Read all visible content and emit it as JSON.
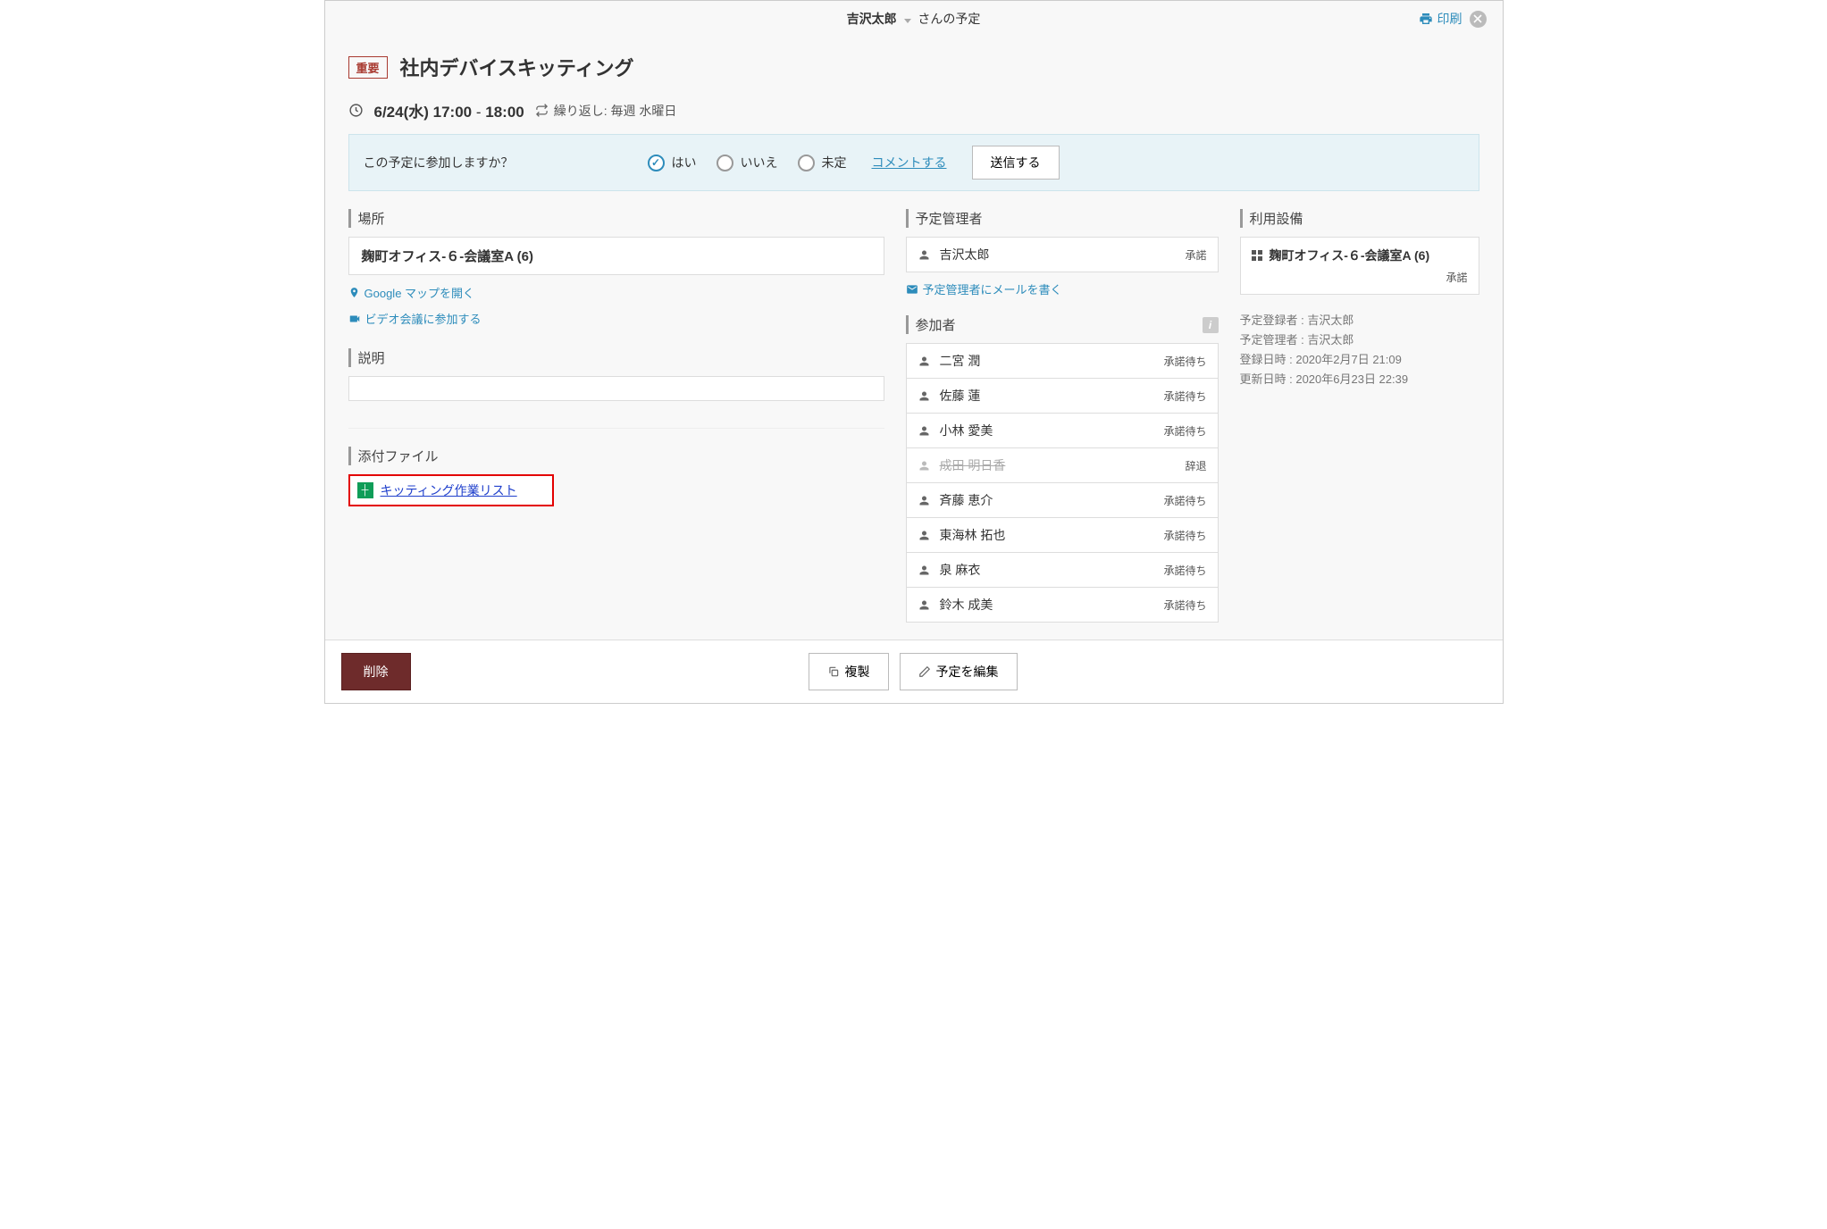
{
  "header": {
    "user": "吉沢太郎",
    "suffix": "さんの予定",
    "print": "印刷"
  },
  "event": {
    "tag": "重要",
    "title": "社内デバイスキッティング",
    "date": "6/24(水) 17:00",
    "date_sep": "-",
    "date_end": "18:00",
    "repeat": "繰り返し: 毎週 水曜日"
  },
  "rsvp": {
    "question": "この予定に参加しますか？",
    "yes": "はい",
    "no": "いいえ",
    "undecided": "未定",
    "comment": "コメントする",
    "submit": "送信する"
  },
  "sections": {
    "location": "場所",
    "description": "説明",
    "attachments": "添付ファイル",
    "organizer": "予定管理者",
    "participants": "参加者",
    "facility": "利用設備"
  },
  "location": {
    "text": "麹町オフィス-６-会議室A (6)",
    "map_link": "Google マップを開く",
    "video_link": "ビデオ会議に参加する"
  },
  "attachments": [
    {
      "name": "キッティング作業リスト"
    }
  ],
  "organizer": {
    "name": "吉沢太郎",
    "status": "承諾",
    "email_link": "予定管理者にメールを書く"
  },
  "participants": [
    {
      "name": "二宮 潤",
      "status": "承諾待ち",
      "declined": false
    },
    {
      "name": "佐藤 蓮",
      "status": "承諾待ち",
      "declined": false
    },
    {
      "name": "小林 愛美",
      "status": "承諾待ち",
      "declined": false
    },
    {
      "name": "成田 明日香",
      "status": "辞退",
      "declined": true
    },
    {
      "name": "斉藤 恵介",
      "status": "承諾待ち",
      "declined": false
    },
    {
      "name": "東海林 拓也",
      "status": "承諾待ち",
      "declined": false
    },
    {
      "name": "泉 麻衣",
      "status": "承諾待ち",
      "declined": false
    },
    {
      "name": "鈴木 成美",
      "status": "承諾待ち",
      "declined": false
    }
  ],
  "facility": {
    "name": "麹町オフィス-６-会議室A (6)",
    "status": "承諾"
  },
  "meta": {
    "creator": "予定登録者 : 吉沢太郎",
    "manager": "予定管理者 : 吉沢太郎",
    "created": "登録日時 : 2020年2月7日 21:09",
    "updated": "更新日時 : 2020年6月23日 22:39"
  },
  "footer": {
    "delete": "削除",
    "copy": "複製",
    "edit": "予定を編集"
  }
}
